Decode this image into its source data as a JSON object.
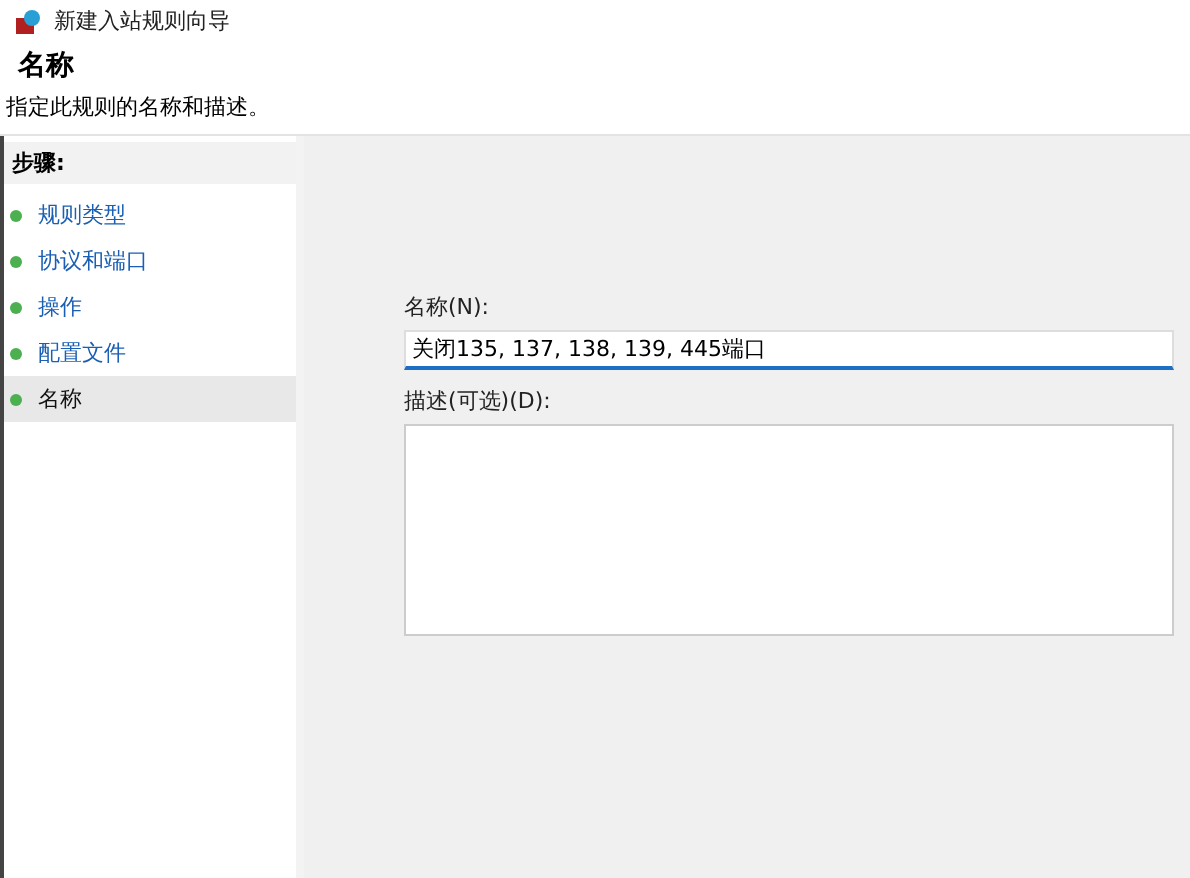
{
  "window": {
    "title": "新建入站规则向导"
  },
  "header": {
    "title": "名称",
    "description": "指定此规则的名称和描述。"
  },
  "steps": {
    "heading": "步骤:",
    "items": [
      {
        "label": "规则类型",
        "selected": false
      },
      {
        "label": "协议和端口",
        "selected": false
      },
      {
        "label": "操作",
        "selected": false
      },
      {
        "label": "配置文件",
        "selected": false
      },
      {
        "label": "名称",
        "selected": true
      }
    ]
  },
  "form": {
    "name_label": "名称(N):",
    "name_value": "关闭135, 137, 138, 139, 445端口",
    "description_label": "描述(可选)(D):"
  }
}
